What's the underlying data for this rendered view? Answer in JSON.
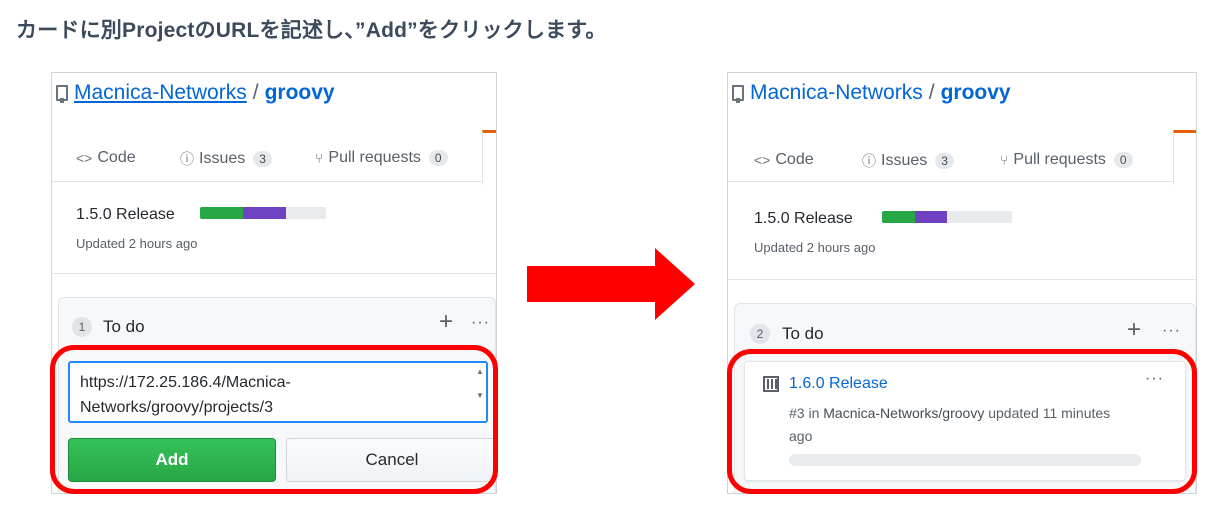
{
  "heading": "カードに別ProjectのURLを記述し、”Add”をクリックします。",
  "colors": {
    "highlight": "#ff0000",
    "arrow": "#ff0000",
    "link": "#0366d6",
    "add_button": "#28a745",
    "progress_green": "#28a745",
    "progress_purple": "#6f42c1"
  },
  "left": {
    "repo": {
      "owner": "Macnica-Networks",
      "separator": "/",
      "name": "groovy"
    },
    "tabs": [
      {
        "icon": "code-icon",
        "glyph": "<>",
        "label": "Code"
      },
      {
        "icon": "issue-icon",
        "glyph": "ⓘ",
        "label": "Issues",
        "count": "3"
      },
      {
        "icon": "pull-request-icon",
        "glyph": "⑂",
        "label": "Pull requests",
        "count": "0"
      }
    ],
    "milestone": {
      "name": "1.5.0 Release",
      "updated": "Updated 2 hours ago",
      "progress_green": 0.34,
      "progress_purple": 0.34
    },
    "column": {
      "count": "1",
      "title": "To do",
      "plus": "+",
      "menu": "···"
    },
    "url_input": "https://172.25.186.4/Macnica-Networks/groovy/projects/3",
    "add_label": "Add",
    "cancel_label": "Cancel"
  },
  "right": {
    "repo": {
      "owner": "Macnica-Networks",
      "separator": "/",
      "name": "groovy"
    },
    "tabs": [
      {
        "icon": "code-icon",
        "glyph": "<>",
        "label": "Code"
      },
      {
        "icon": "issue-icon",
        "glyph": "ⓘ",
        "label": "Issues",
        "count": "3"
      },
      {
        "icon": "pull-request-icon",
        "glyph": "⑂",
        "label": "Pull requests",
        "count": "0"
      }
    ],
    "milestone": {
      "name": "1.5.0 Release",
      "updated": "Updated 2 hours ago",
      "progress_green": 0.25,
      "progress_purple": 0.25
    },
    "column": {
      "count": "2",
      "title": "To do",
      "plus": "+",
      "menu": "···"
    },
    "card": {
      "title": "1.6.0 Release",
      "number": "#3",
      "in_text": "in",
      "repo": "Macnica-Networks/groovy",
      "updated": "updated 11 minutes ago",
      "menu": "···"
    }
  }
}
